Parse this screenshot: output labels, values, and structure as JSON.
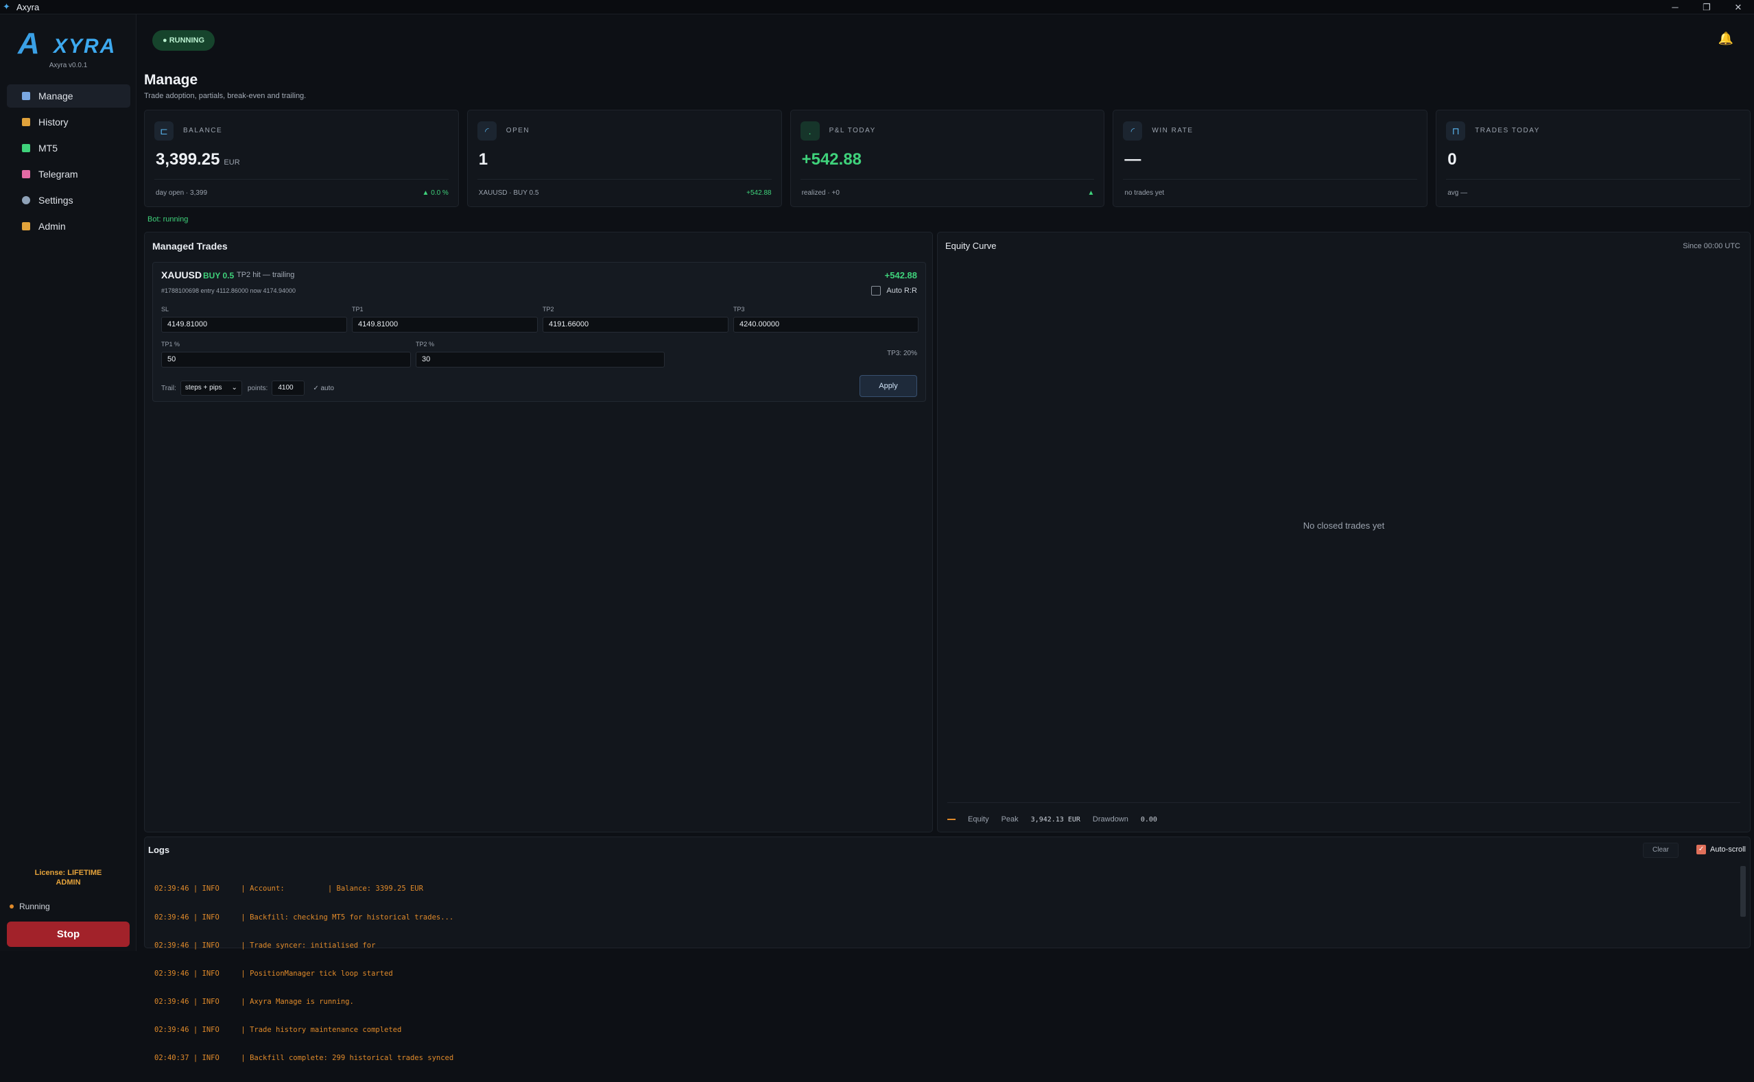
{
  "window": {
    "title": "Axyra",
    "controls": [
      "─",
      "❐",
      "✕"
    ]
  },
  "sidebar": {
    "brand": "XYRA",
    "version": "Axyra v0.0.1",
    "items": [
      {
        "label": "Manage",
        "icon": "chart-icon",
        "color": "#7aa7e0",
        "active": true
      },
      {
        "label": "History",
        "icon": "book-icon",
        "color": "#e0a23b"
      },
      {
        "label": "MT5",
        "icon": "chart-green-icon",
        "color": "#3fd27b"
      },
      {
        "label": "Telegram",
        "icon": "mail-icon",
        "color": "#e36aa4"
      },
      {
        "label": "Settings",
        "icon": "gear-icon",
        "color": "#8fa2b8"
      },
      {
        "label": "Admin",
        "icon": "crown-icon",
        "color": "#e0a23b"
      }
    ],
    "license_line1": "License: LIFETIME",
    "license_line2": "ADMIN",
    "status": "Running",
    "stop_label": "Stop"
  },
  "header": {
    "status_pill": "● RUNNING",
    "bell": "🔔"
  },
  "page": {
    "title": "Manage",
    "subtitle": "Trade adoption, partials, break-even and trailing."
  },
  "stats": [
    {
      "label": "BALANCE",
      "value": "3,399.25",
      "unit": "EUR",
      "foot": "day open · 3,399",
      "right": "▲ 0.0 %"
    },
    {
      "label": "OPEN",
      "value": "1",
      "foot": "XAUUSD · BUY 0.5",
      "right": "+542.88"
    },
    {
      "label": "P&L TODAY",
      "value": "+542.88",
      "foot": "realized · +0",
      "right": "▲"
    },
    {
      "label": "WIN RATE",
      "value": "—",
      "foot": "no trades yet",
      "right": ""
    },
    {
      "label": "TRADES TODAY",
      "value": "0",
      "foot": "avg —",
      "right": ""
    }
  ],
  "bot_status": "Bot: running",
  "managed": {
    "title": "Managed Trades",
    "trade": {
      "symbol": "XAUUSD",
      "side": "BUY 0.5",
      "status": "TP2 hit — trailing",
      "meta": "#1788100698   entry 4112.86000   now 4174.94000",
      "pnl": "+542.88",
      "auto_rr": "Auto R:R",
      "sl_label": "SL",
      "sl": "4149.81000",
      "tp1_label": "TP1",
      "tp1": "4149.81000",
      "tp2_label": "TP2",
      "tp2": "4191.66000",
      "tp3_label": "TP3",
      "tp3": "4240.00000",
      "tp1p_label": "TP1 %",
      "tp1p": "50",
      "tp2p_label": "TP2 %",
      "tp2p": "30",
      "tp3_note": "TP3: 20%",
      "trail_label": "Trail:",
      "trail_mode": "steps + pips",
      "points_label": "points:",
      "points": "4100",
      "auto_label": "✓  auto",
      "apply": "Apply"
    }
  },
  "equity": {
    "title": "Equity Curve",
    "since": "Since 00:00 UTC",
    "empty": "No closed trades yet",
    "legend_equity": "Equity",
    "legend_peak": "Peak",
    "peak_value": "3,942.13 EUR",
    "legend_dd": "Drawdown",
    "dd_value": "0.00"
  },
  "logs": {
    "title": "Logs",
    "clear": "Clear",
    "autoscroll": "Auto-scroll",
    "lines": [
      "02:39:46 | INFO     | Account:          | Balance: 3399.25 EUR",
      "02:39:46 | INFO     | Backfill: checking MT5 for historical trades...",
      "02:39:46 | INFO     | Trade syncer: initialised for",
      "02:39:46 | INFO     | PositionManager tick loop started",
      "02:39:46 | INFO     | Axyra Manage is running.",
      "02:39:46 | INFO     | Trade history maintenance completed",
      "02:40:37 | INFO     | Backfill complete: 299 historical trades synced"
    ]
  }
}
